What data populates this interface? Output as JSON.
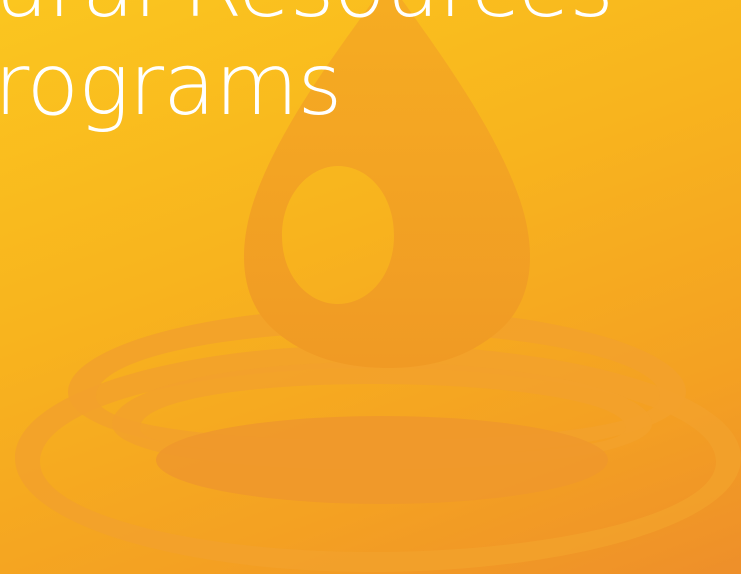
{
  "tile": {
    "title_line1": "ural Resources",
    "title_line2": "rograms",
    "logo_icon": "water-drop-ripple-icon",
    "colors": {
      "background_top": "#fbc61f",
      "background_bottom": "#ee8f2a",
      "logo_fill": "#f3a12a",
      "text": "#ffffff"
    }
  }
}
